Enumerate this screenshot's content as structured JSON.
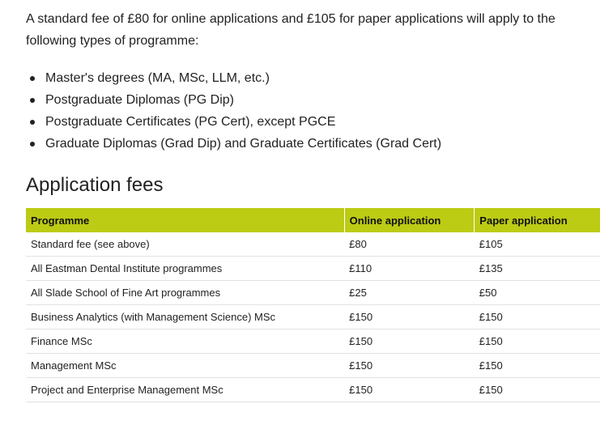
{
  "intro_text": "A standard fee of £80 for online applications and £105 for paper applications will apply to the following types of programme:",
  "programme_types": [
    "Master's degrees (MA, MSc, LLM, etc.)",
    "Postgraduate Diplomas (PG Dip)",
    "Postgraduate Certificates (PG Cert), except PGCE",
    "Graduate Diplomas (Grad Dip) and Graduate Certificates (Grad Cert)"
  ],
  "section_title": "Application fees",
  "table": {
    "header_color": "#bccb14",
    "headers": [
      "Programme",
      "Online application",
      "Paper application"
    ],
    "rows": [
      [
        "Standard fee (see above)",
        "£80",
        "£105"
      ],
      [
        "All Eastman Dental Institute programmes",
        "£110",
        "£135"
      ],
      [
        "All Slade School of Fine Art programmes",
        "£25",
        "£50"
      ],
      [
        "Business Analytics (with Management Science) MSc",
        "£150",
        "£150"
      ],
      [
        "Finance MSc",
        "£150",
        "£150"
      ],
      [
        "Management MSc",
        "£150",
        "£150"
      ],
      [
        "Project and Enterprise Management MSc",
        "£150",
        "£150"
      ]
    ]
  }
}
